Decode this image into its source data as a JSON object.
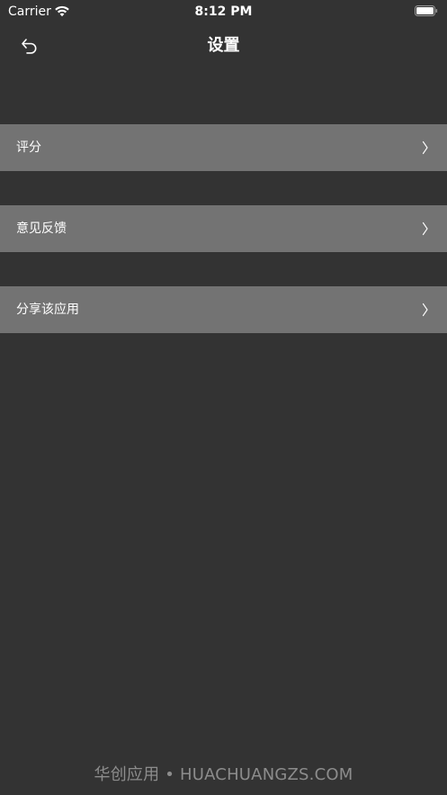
{
  "status_bar": {
    "carrier": "Carrier",
    "time": "8:12 PM",
    "icons": [
      "wifi-icon",
      "battery-icon"
    ]
  },
  "nav": {
    "back_icon": "back-arrow-icon",
    "title": "设置"
  },
  "settings": {
    "items": [
      {
        "label": "评分",
        "icon": "chevron-right-icon"
      },
      {
        "label": "意见反馈",
        "icon": "chevron-right-icon"
      },
      {
        "label": "分享该应用",
        "icon": "chevron-right-icon"
      }
    ]
  },
  "watermark": {
    "text": "华创应用 • HUACHUANGZS.COM"
  },
  "colors": {
    "background": "#333333",
    "row_background": "#737373",
    "text": "#ffffff",
    "watermark": "#8c8c8c"
  }
}
